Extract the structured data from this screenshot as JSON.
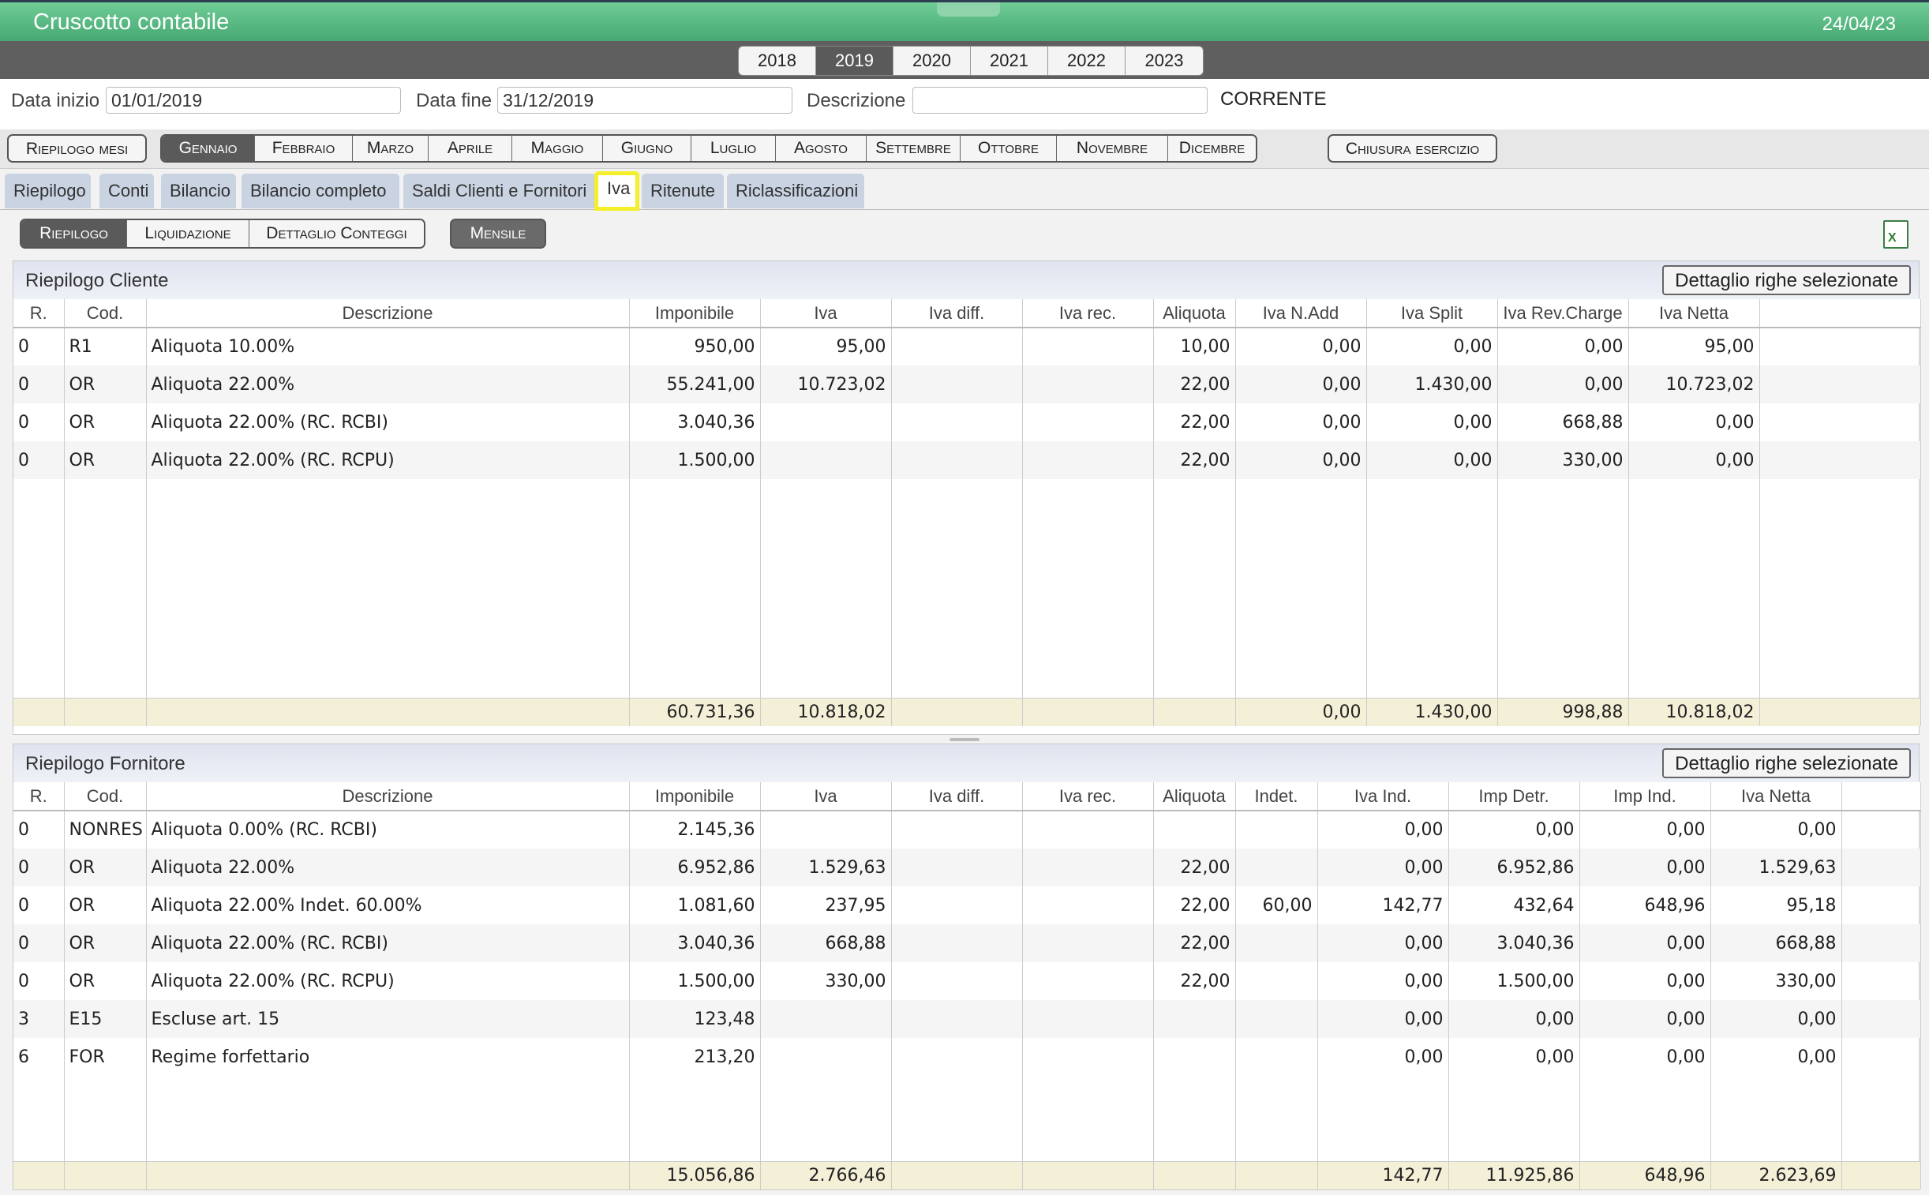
{
  "app": {
    "title": "Cruscotto contabile",
    "date": "24/04/23"
  },
  "years": [
    {
      "label": "2018",
      "selected": false
    },
    {
      "label": "2019",
      "selected": true
    },
    {
      "label": "2020",
      "selected": false
    },
    {
      "label": "2021",
      "selected": false
    },
    {
      "label": "2022",
      "selected": false
    },
    {
      "label": "2023",
      "selected": false
    }
  ],
  "filters": {
    "data_inizio_label": "Data inizio",
    "data_inizio_value": "01/01/2019",
    "data_fine_label": "Data fine",
    "data_fine_value": "31/12/2019",
    "descrizione_label": "Descrizione",
    "descrizione_value": "",
    "status": "CORRENTE"
  },
  "monthbar": {
    "riepilogo_mesi": "Riepilogo mesi",
    "months": [
      "Gennaio",
      "Febbraio",
      "Marzo",
      "Aprile",
      "Maggio",
      "Giugno",
      "Luglio",
      "Agosto",
      "Settembre",
      "Ottobre",
      "Novembre",
      "Dicembre"
    ],
    "selected_month": "Gennaio",
    "chiusura": "Chiusura esercizio"
  },
  "tabs": [
    "Riepilogo",
    "Conti",
    "Bilancio",
    "Bilancio completo",
    "Saldi Clienti e Fornitori",
    "Iva",
    "Ritenute",
    "Riclassificazioni"
  ],
  "active_tab": "Iva",
  "subtabs": [
    "Riepilogo",
    "Liquidazione",
    "Dettaglio Conteggi"
  ],
  "active_subtab": "Riepilogo",
  "mensile": "Mensile",
  "excel_icon": "X",
  "cliente": {
    "title": "Riepilogo Cliente",
    "button": "Dettaglio righe selezionate",
    "columns": [
      "R.",
      "Cod.",
      "Descrizione",
      "Imponibile",
      "Iva",
      "Iva diff.",
      "Iva rec.",
      "Aliquota",
      "Iva N.Add",
      "Iva Split",
      "Iva Rev.Charge",
      "Iva Netta",
      ""
    ],
    "rows": [
      [
        "0",
        "R1",
        "Aliquota 10.00%",
        "950,00",
        "95,00",
        "",
        "",
        "10,00",
        "0,00",
        "0,00",
        "0,00",
        "95,00",
        ""
      ],
      [
        "0",
        "OR",
        "Aliquota 22.00%",
        "55.241,00",
        "10.723,02",
        "",
        "",
        "22,00",
        "0,00",
        "1.430,00",
        "0,00",
        "10.723,02",
        ""
      ],
      [
        "0",
        "OR",
        "Aliquota 22.00% (RC. RCBI)",
        "3.040,36",
        "",
        "",
        "",
        "22,00",
        "0,00",
        "0,00",
        "668,88",
        "0,00",
        ""
      ],
      [
        "0",
        "OR",
        "Aliquota 22.00% (RC. RCPU)",
        "1.500,00",
        "",
        "",
        "",
        "22,00",
        "0,00",
        "0,00",
        "330,00",
        "0,00",
        ""
      ]
    ],
    "totals": [
      "",
      "",
      "",
      "60.731,36",
      "10.818,02",
      "",
      "",
      "",
      "0,00",
      "1.430,00",
      "998,88",
      "10.818,02",
      ""
    ]
  },
  "fornitore": {
    "title": "Riepilogo Fornitore",
    "button": "Dettaglio righe selezionate",
    "columns": [
      "R.",
      "Cod.",
      "Descrizione",
      "Imponibile",
      "Iva",
      "Iva diff.",
      "Iva rec.",
      "Aliquota",
      "Indet.",
      "Iva Ind.",
      "Imp Detr.",
      "Imp Ind.",
      "Iva Netta",
      ""
    ],
    "rows": [
      [
        "0",
        "NONRES",
        "Aliquota 0.00% (RC. RCBI)",
        "2.145,36",
        "",
        "",
        "",
        "",
        "",
        "0,00",
        "0,00",
        "0,00",
        "0,00",
        ""
      ],
      [
        "0",
        "OR",
        "Aliquota 22.00%",
        "6.952,86",
        "1.529,63",
        "",
        "",
        "22,00",
        "",
        "0,00",
        "6.952,86",
        "0,00",
        "1.529,63",
        ""
      ],
      [
        "0",
        "OR",
        "Aliquota 22.00% Indet. 60.00%",
        "1.081,60",
        "237,95",
        "",
        "",
        "22,00",
        "60,00",
        "142,77",
        "432,64",
        "648,96",
        "95,18",
        ""
      ],
      [
        "0",
        "OR",
        "Aliquota 22.00% (RC. RCBI)",
        "3.040,36",
        "668,88",
        "",
        "",
        "22,00",
        "",
        "0,00",
        "3.040,36",
        "0,00",
        "668,88",
        ""
      ],
      [
        "0",
        "OR",
        "Aliquota 22.00% (RC. RCPU)",
        "1.500,00",
        "330,00",
        "",
        "",
        "22,00",
        "",
        "0,00",
        "1.500,00",
        "0,00",
        "330,00",
        ""
      ],
      [
        "3",
        "E15",
        "Escluse art. 15",
        "123,48",
        "",
        "",
        "",
        "",
        "",
        "0,00",
        "0,00",
        "0,00",
        "0,00",
        ""
      ],
      [
        "6",
        "FOR",
        "Regime forfettario",
        "213,20",
        "",
        "",
        "",
        "",
        "",
        "0,00",
        "0,00",
        "0,00",
        "0,00",
        ""
      ]
    ],
    "totals": [
      "",
      "",
      "",
      "15.056,86",
      "2.766,46",
      "",
      "",
      "",
      "",
      "142,77",
      "11.925,86",
      "648,96",
      "2.623,69",
      ""
    ]
  }
}
